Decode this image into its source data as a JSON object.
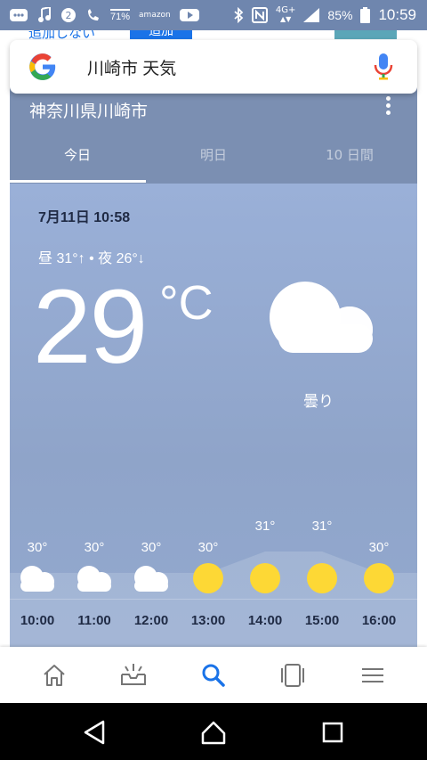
{
  "status_bar": {
    "battery_percent": "85%",
    "time": "10:59",
    "network": "4G+",
    "small_badge": "71%",
    "notif_badge": "2",
    "amazon": "amazon"
  },
  "page_behind": {
    "text": "追加しない",
    "button": "追加"
  },
  "search": {
    "query": "川崎市 天気"
  },
  "weather": {
    "location": "神奈川県川崎市",
    "tabs": [
      {
        "label": "今日"
      },
      {
        "label": "明日"
      },
      {
        "label": "10 日間"
      }
    ],
    "datetime": "7月11日 10:58",
    "hilo": "昼 31°↑ • 夜 26°↓",
    "temperature": "29",
    "unit": "°C",
    "condition": "曇り",
    "hourly": [
      {
        "time": "10:00",
        "temp": "30°",
        "temp_value": 30,
        "icon": "cloud-icon"
      },
      {
        "time": "11:00",
        "temp": "30°",
        "temp_value": 30,
        "icon": "cloud-icon"
      },
      {
        "time": "12:00",
        "temp": "30°",
        "temp_value": 30,
        "icon": "cloud-icon"
      },
      {
        "time": "13:00",
        "temp": "30°",
        "temp_value": 30,
        "icon": "sun-icon"
      },
      {
        "time": "14:00",
        "temp": "31°",
        "temp_value": 31,
        "icon": "sun-icon"
      },
      {
        "time": "15:00",
        "temp": "31°",
        "temp_value": 31,
        "icon": "sun-icon"
      },
      {
        "time": "16:00",
        "temp": "30°",
        "temp_value": 30,
        "icon": "sun-icon"
      }
    ]
  },
  "bottom_nav": {
    "items": [
      "home-icon",
      "updates-icon",
      "search-icon",
      "tabs-icon",
      "menu-icon"
    ],
    "active_color": "#1a73e8"
  },
  "colors": {
    "google_blue": "#4285f4",
    "google_red": "#ea4335",
    "google_yellow": "#fbbc05",
    "google_green": "#34a853",
    "sun": "#fdd835"
  }
}
